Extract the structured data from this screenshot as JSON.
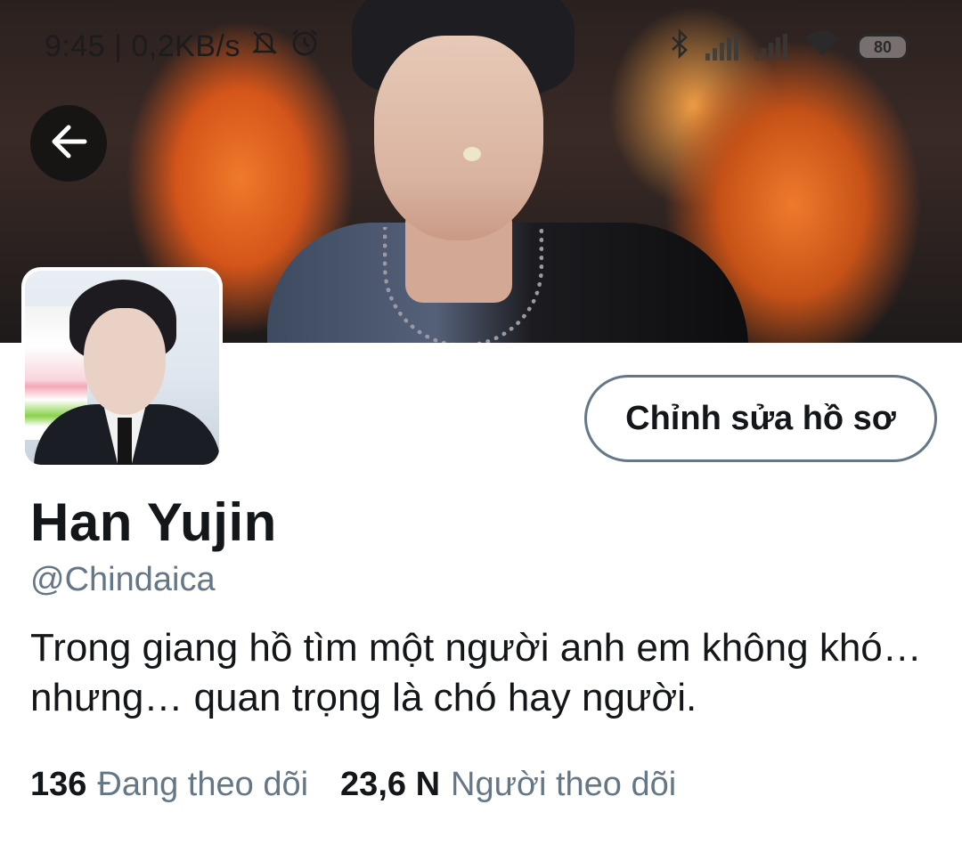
{
  "status_bar": {
    "time_speed": "9:45 | 0,2KB/s",
    "battery": "80",
    "icons": [
      "mute-bell-icon",
      "alarm-icon",
      "bluetooth-icon",
      "signal-icon",
      "wifi-icon",
      "battery-icon"
    ]
  },
  "header": {
    "back_icon": "arrow-left-icon"
  },
  "profile": {
    "edit_button": "Chỉnh sửa hồ sơ",
    "display_name": "Han Yujin",
    "handle": "@Chindaica",
    "bio": "Trong giang hồ tìm một người anh em không khó… nhưng… quan trọng là chó hay người.",
    "following_count": "136",
    "following_label": "Đang theo dõi",
    "followers_count": "23,6 N",
    "followers_label": "Người theo dõi"
  },
  "colors": {
    "text_primary": "#14171a",
    "text_secondary": "#657786",
    "button_border": "#657786"
  }
}
